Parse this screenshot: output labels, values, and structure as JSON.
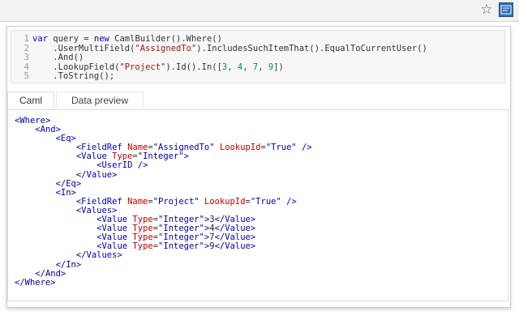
{
  "toolbar": {
    "icons": [
      "star-icon",
      "caml-extension-icon"
    ],
    "star_glyph": "☆"
  },
  "editor": {
    "line_numbers": [
      "1",
      "2",
      "3",
      "4",
      "5"
    ],
    "lines": [
      "var query = new CamlBuilder().Where()",
      "    .UserMultiField(\"AssignedTo\").IncludesSuchItemThat().EqualToCurrentUser()",
      "    .And()",
      "    .LookupField(\"Project\").Id().In([3, 4, 7, 9])",
      "    .ToString();"
    ]
  },
  "tabs": [
    {
      "label": "Caml",
      "active": true
    },
    {
      "label": "Data preview",
      "active": false
    }
  ],
  "xml_output": [
    "<Where>",
    "    <And>",
    "        <Eq>",
    "            <FieldRef Name=\"AssignedTo\" LookupId=\"True\" />",
    "            <Value Type=\"Integer\">",
    "                <UserID />",
    "            </Value>",
    "        </Eq>",
    "        <In>",
    "            <FieldRef Name=\"Project\" LookupId=\"True\" />",
    "            <Values>",
    "                <Value Type=\"Integer\">3</Value>",
    "                <Value Type=\"Integer\">4</Value>",
    "                <Value Type=\"Integer\">7</Value>",
    "                <Value Type=\"Integer\">9</Value>",
    "            </Values>",
    "        </In>",
    "    </And>",
    "</Where>"
  ],
  "colors": {
    "tag": "#0000aa",
    "attr_name": "#c00000",
    "string": "#a31515",
    "keyword": "#0000cc"
  }
}
